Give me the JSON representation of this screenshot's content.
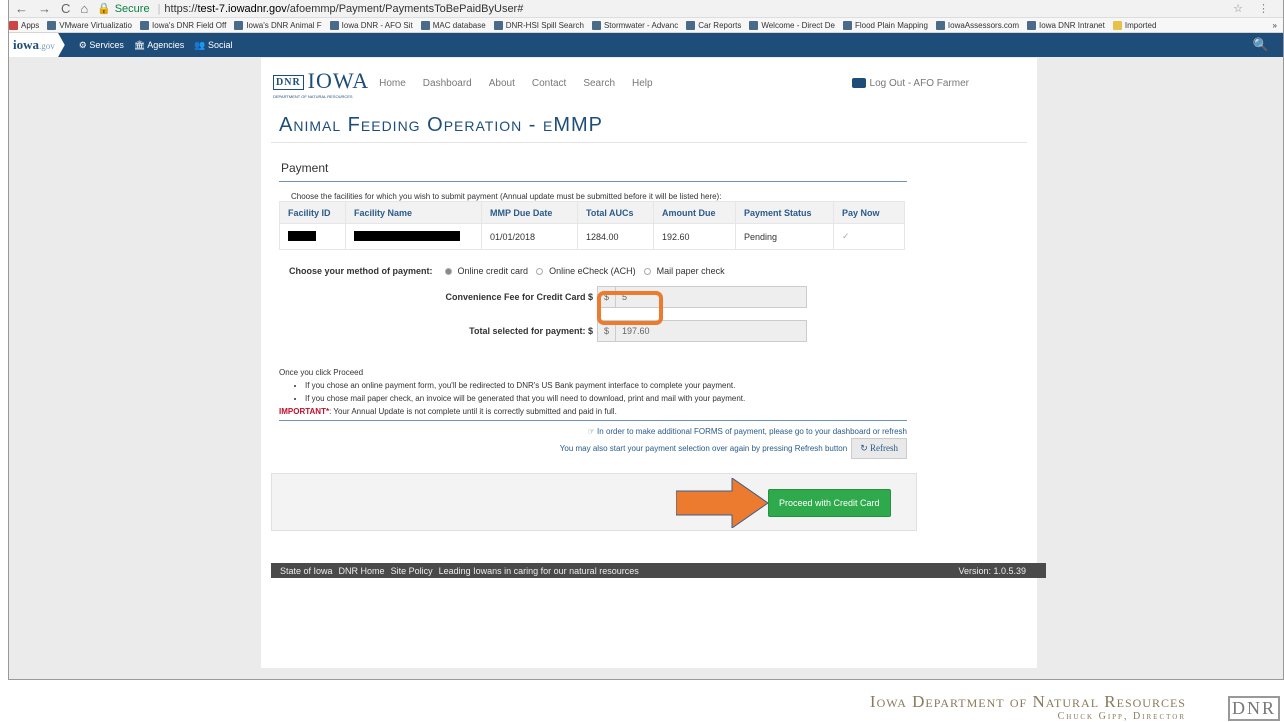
{
  "browser": {
    "secure_label": "Secure",
    "url_scheme": "https://",
    "url_host": "test-7.iowadnr.gov",
    "url_path": "/afoemmp/Payment/PaymentsToBePaidByUser#",
    "bookmarks": [
      "Apps",
      "VMware Virtualizatio",
      "Iowa's DNR Field Off",
      "Iowa's DNR Animal F",
      "Iowa DNR - AFO Sit",
      "MAC database",
      "DNR-HSI Spill Search",
      "Stormwater - Advanc",
      "Car Reports",
      "Welcome - Direct De",
      "Flood Plain Mapping",
      "IowaAssessors.com",
      "Iowa DNR Intranet",
      "Imported"
    ],
    "more": "»"
  },
  "govbar": {
    "logo": "iowa",
    "logo_suffix": ".gov",
    "services": "Services",
    "agencies": "Agencies",
    "social": "Social"
  },
  "header": {
    "logo_badge": "DNR",
    "logo_text": "IOWA",
    "logo_sub": "DEPARTMENT OF NATURAL RESOURCES",
    "menu": [
      "Home",
      "Dashboard",
      "About",
      "Contact",
      "Search",
      "Help"
    ],
    "logout": "Log Out - AFO Farmer"
  },
  "title": "Animal Feeding Operation - eMMP",
  "section": "Payment",
  "choose_text": "Choose the facilities for which you wish to submit payment (Annual update must be submitted before it will be listed here):",
  "table": {
    "headers": [
      "Facility ID",
      "Facility Name",
      "MMP Due Date",
      "Total AUCs",
      "Amount Due",
      "Payment Status",
      "Pay Now"
    ],
    "row": {
      "due_date": "01/01/2018",
      "aucs": "1284.00",
      "amount": "192.60",
      "status": "Pending",
      "check": "✓"
    }
  },
  "method": {
    "label": "Choose your method of payment:",
    "options": [
      "Online credit card",
      "Online eCheck (ACH)",
      "Mail paper check"
    ]
  },
  "fees": {
    "fee_label": "Convenience Fee for Credit Card $",
    "currency": "$",
    "fee_value": "5",
    "total_label": "Total selected for payment: $",
    "total_value": "197.60"
  },
  "info": {
    "intro": "Once you click Proceed",
    "bullets": [
      "If you chose an online payment form, you'll be redirected to DNR's US Bank payment interface to complete your payment.",
      "If you chose mail paper check, an invoice will be generated that you will need to download, print and mail with your payment."
    ],
    "important_label": "IMPORTANT*",
    "important_text": ": Your Annual Update is not complete until it is correctly submitted and paid in full."
  },
  "notes": {
    "forms": "In order to make additional FORMS of payment, please go to your dashboard or refresh",
    "restart": "You may also start your payment selection over again by pressing Refresh button",
    "refresh": "Refresh"
  },
  "proceed": "Proceed with Credit Card",
  "footer": {
    "links": [
      "State of Iowa",
      "DNR Home",
      "Site Policy",
      "Leading Iowans in caring for our natural resources"
    ],
    "version": "Version: 1.0.5.39"
  },
  "band": {
    "dept": "Iowa Department of Natural Resources",
    "director": "Chuck Gipp, Director",
    "logo": "DNR"
  },
  "colors": {
    "arrow": "#ec7a2f",
    "highlight": "#ec7a2f",
    "proceed": "#2eaa4c",
    "brand": "#1f4d7a"
  }
}
